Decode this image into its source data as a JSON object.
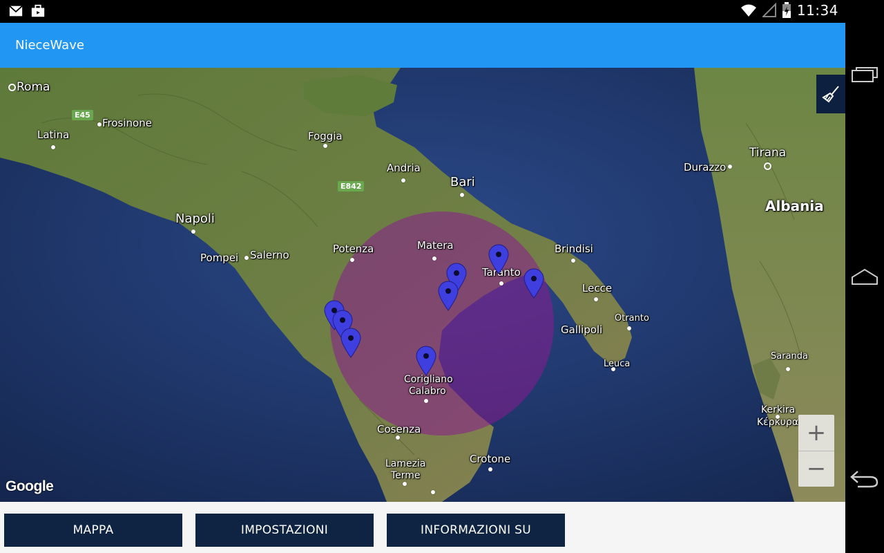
{
  "status_bar": {
    "time": "11:34",
    "icons": [
      "gmail-icon",
      "briefcase-icon",
      "wifi-icon",
      "signal-icon",
      "battery-icon"
    ]
  },
  "app": {
    "title": "NieceWave",
    "accent": "#2196f3"
  },
  "map": {
    "labels": {
      "roma": "Roma",
      "frosinone": "Frosinone",
      "latina": "Latina",
      "foggia": "Foggia",
      "andria": "Andria",
      "bari": "Bari",
      "napoli": "Napoli",
      "pompei": "Pompei",
      "salerno": "Salerno",
      "potenza": "Potenza",
      "matera": "Matera",
      "taranto": "Taranto",
      "brindisi": "Brindisi",
      "lecce": "Lecce",
      "gallipoli": "Gallipoli",
      "otranto": "Otranto",
      "leuca": "Leuca",
      "corigliano": "Corigliano",
      "calabro": "Calabro",
      "cosenza": "Cosenza",
      "crotone": "Crotone",
      "lamezia": "Lamezia",
      "terme": "Terme",
      "tirana": "Tirana",
      "durazzo": "Durazzo",
      "albania": "Albania",
      "saranda": "Saranda",
      "kerkira": "Kerkira",
      "kerkyra": "Κέρκυρα"
    },
    "roads": {
      "e45": "E45",
      "e842": "E842"
    },
    "logo": "Google",
    "circle_color": "#8b1c8f",
    "marker_color": "#3f3fe0",
    "zoom_in": "+",
    "zoom_out": "−"
  },
  "nav_buttons": {
    "mappa": "MAPPA",
    "impostazioni": "IMPOSTAZIONI",
    "informazioni": "INFORMAZIONI SU"
  }
}
